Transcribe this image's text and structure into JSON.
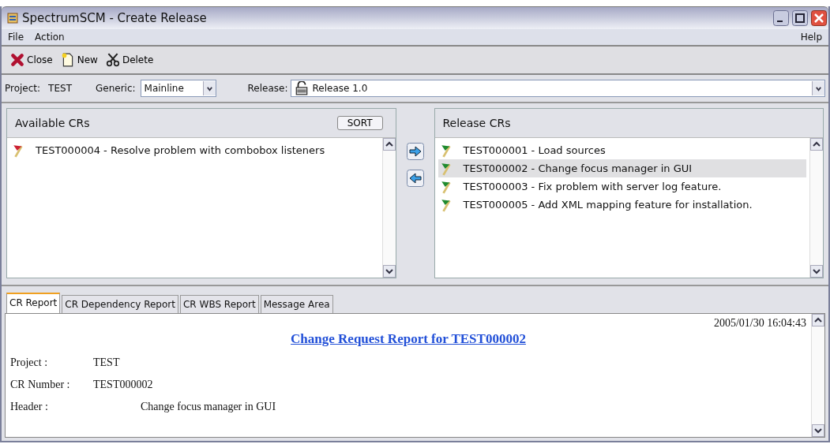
{
  "window": {
    "title": "SpectrumSCM - Create Release"
  },
  "menu": {
    "left": [
      "File",
      "Action"
    ],
    "right": [
      "Help"
    ]
  },
  "toolbar": [
    {
      "label": "Close",
      "kind": "close"
    },
    {
      "label": "New",
      "kind": "new"
    },
    {
      "label": "Delete",
      "kind": "delete"
    }
  ],
  "selection": {
    "project_label": "Project:",
    "project": "TEST",
    "generic_label": "Generic:",
    "generic": "Mainline",
    "release_label": "Release:",
    "release": "Release 1.0"
  },
  "available": {
    "title": "Available CRs",
    "sort_button": "SORT",
    "items": [
      {
        "text": "TEST000004 - Resolve problem with combobox listeners",
        "selected": false,
        "color": "#cc2233"
      }
    ]
  },
  "release_crs": {
    "title": "Release CRs",
    "items": [
      {
        "text": "TEST000001 - Load sources",
        "selected": false,
        "color": "#1f8a2e"
      },
      {
        "text": "TEST000002 - Change focus manager in GUI",
        "selected": true,
        "color": "#1f8a2e"
      },
      {
        "text": "TEST000003 - Fix problem with server log feature.",
        "selected": false,
        "color": "#1f8a2e"
      },
      {
        "text": "TEST000005 - Add XML mapping feature for installation.",
        "selected": false,
        "color": "#1f8a2e"
      }
    ]
  },
  "tabs": [
    {
      "label": "CR Report",
      "selected": true
    },
    {
      "label": "CR Dependency Report",
      "selected": false
    },
    {
      "label": "CR WBS Report",
      "selected": false
    },
    {
      "label": "Message Area",
      "selected": false
    }
  ],
  "report": {
    "timestamp": "2005/01/30 16:04:43",
    "title": "Change Request Report for TEST000002",
    "fields": [
      {
        "label": "Project :",
        "value": "TEST"
      },
      {
        "label": "CR Number :",
        "value": "TEST000002"
      },
      {
        "label": "Header :",
        "value": "Change focus manager in GUI"
      }
    ]
  }
}
